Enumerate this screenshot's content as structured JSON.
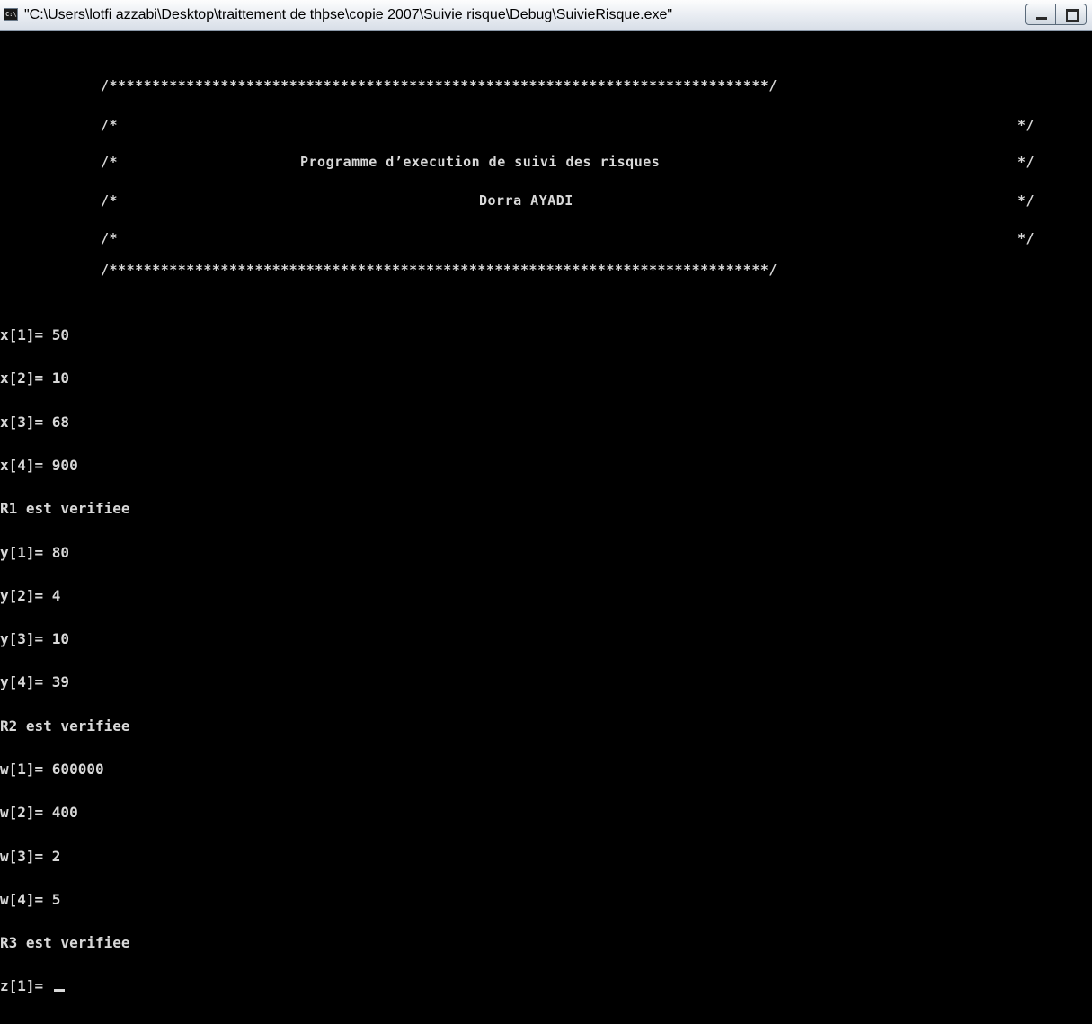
{
  "window": {
    "title": "\"C:\\Users\\lotfi azzabi\\Desktop\\traittement de thþse\\copie 2007\\Suivie risque\\Debug\\SuivieRisque.exe\"",
    "icon": "console-icon"
  },
  "banner": {
    "border_line": "/*****************************************************************************/",
    "blank_left": "/*",
    "blank_right": "*/",
    "title": "Programme d’execution de suivi des risques",
    "author": "Dorra AYADI"
  },
  "output": [
    "x[1]= 50",
    "x[2]= 10",
    "x[3]= 68",
    "x[4]= 900",
    "R1 est verifiee",
    "y[1]= 80",
    "y[2]= 4",
    "y[3]= 10",
    "y[4]= 39",
    "R2 est verifiee",
    "w[1]= 600000",
    "w[2]= 400",
    "w[3]= 2",
    "w[4]= 5",
    "R3 est verifiee"
  ],
  "prompt": "z[1]= "
}
